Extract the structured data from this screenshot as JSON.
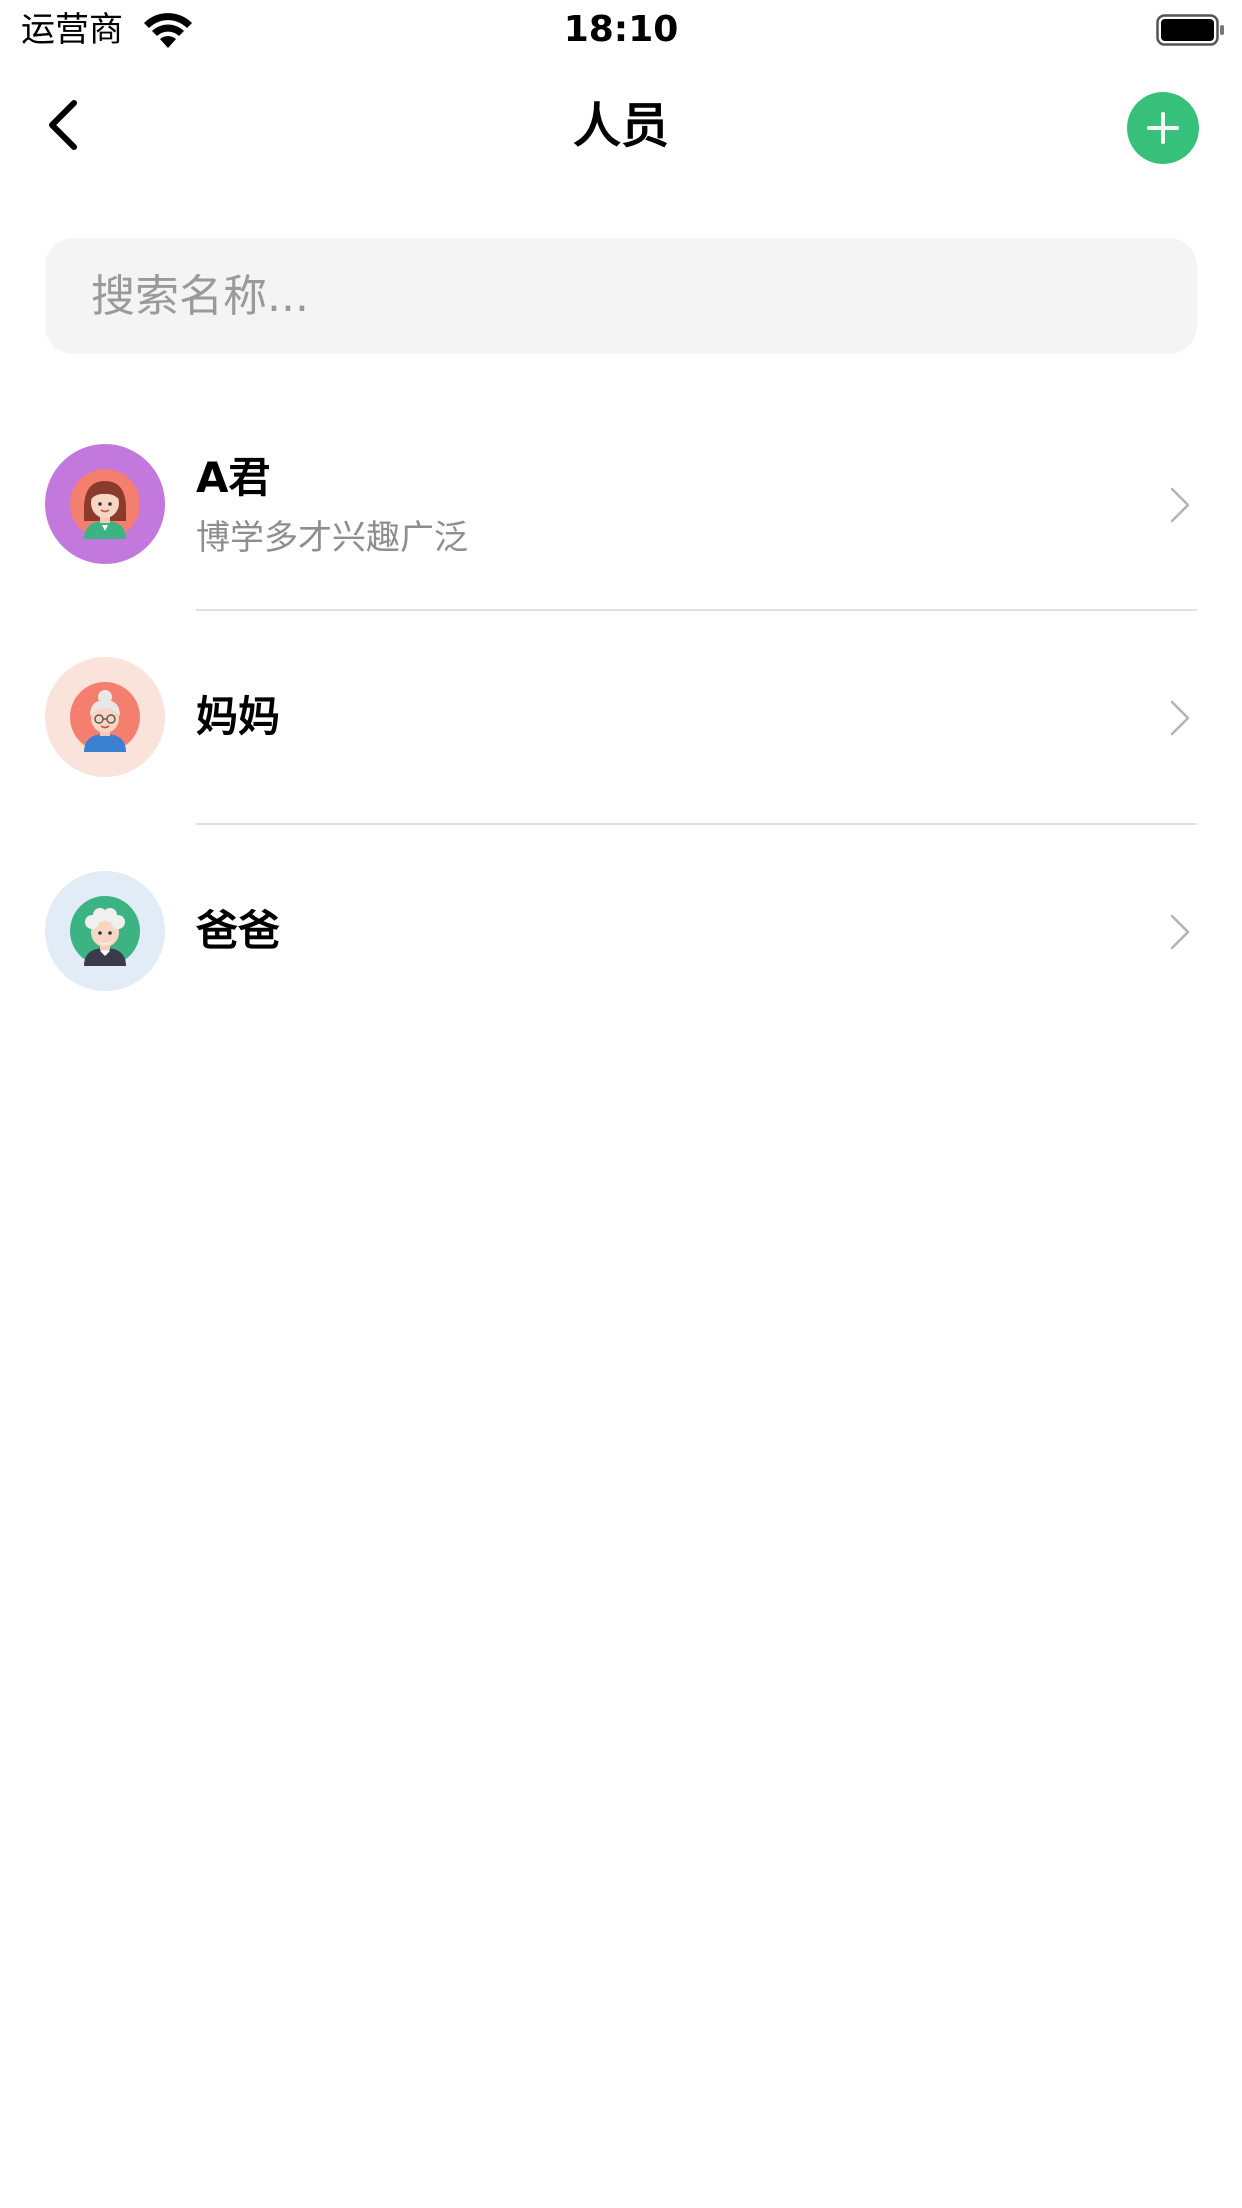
{
  "status_bar": {
    "carrier": "运营商",
    "time": "18:10",
    "wifi_icon": "wifi-icon",
    "battery_icon": "battery-icon"
  },
  "nav": {
    "title": "人员",
    "back_icon": "chevron-left-icon",
    "add_icon": "plus-icon",
    "accent_color": "#36c07a"
  },
  "search": {
    "placeholder": "搜索名称...",
    "value": ""
  },
  "people": [
    {
      "name": "A君",
      "description": "博学多才兴趣广泛",
      "avatar_bg": "#c378dd",
      "avatar_icon": "young-woman-avatar-icon"
    },
    {
      "name": "妈妈",
      "description": "",
      "avatar_bg": "#f9e3da",
      "avatar_icon": "grandmother-avatar-icon"
    },
    {
      "name": "爸爸",
      "description": "",
      "avatar_bg": "#e1ecf7",
      "avatar_icon": "grandfather-avatar-icon"
    }
  ]
}
